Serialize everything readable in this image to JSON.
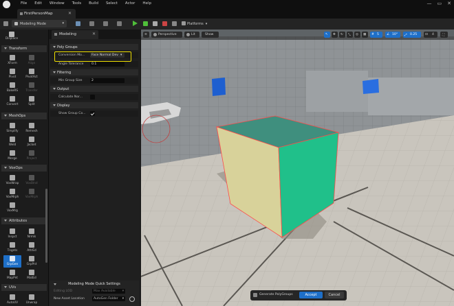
{
  "menubar": {
    "items": [
      "File",
      "Edit",
      "Window",
      "Tools",
      "Build",
      "Select",
      "Actor",
      "Help"
    ],
    "window_controls": [
      "—",
      "▭",
      "✕"
    ]
  },
  "tab": {
    "label": "FirstPersonMap",
    "close": "✕"
  },
  "toolbar": {
    "mode_label": "Modeling Mode",
    "platforms_label": "Platforms"
  },
  "left_panel": {
    "top_tool": "Displace",
    "sections": {
      "transform": "Transform",
      "meshops": "MeshOps",
      "voxops": "VoxOps",
      "attributes": "Attributes",
      "uvs": "UVs"
    },
    "transform_tools": [
      "XForm",
      "Align",
      "Pivot",
      "PivotAct",
      "BakeRS",
      "Transfer",
      "Convert",
      "Split"
    ],
    "meshops_tools": [
      "Simplify",
      "Remesh",
      "Weld",
      "Jacket",
      "Merge",
      "Project"
    ],
    "voxops_tools": [
      "VoxWrap",
      "VoxBlnd",
      "VoxMrph",
      "VoxMrph",
      "VoxMrg"
    ],
    "attribute_tools": [
      "Inspct",
      "Nrmls",
      "Tngnts",
      "AttrEd",
      "GrpGen",
      "GrpPnt",
      "MapPnt",
      "MatEd"
    ],
    "uv_tools": [
      "AutoUV",
      "Unwrap"
    ]
  },
  "detail_panel": {
    "tab_label": "Modeling",
    "tab_close": "✕",
    "polygroups": {
      "header": "Poly Groups",
      "conversion_label": "Conversion Mo...",
      "conversion_value": "Face Normal Dev",
      "angle_label": "Angle Tolerance",
      "angle_value": "0.1"
    },
    "filtering": {
      "header": "Filtering",
      "min_group_label": "Min Group Size",
      "min_group_value": "2"
    },
    "output": {
      "header": "Output",
      "calc_label": "Calculate Nor...",
      "calc_checked": false
    },
    "display": {
      "header": "Display",
      "show_label": "Show Group Co...",
      "show_checked": true
    }
  },
  "quick_settings": {
    "title": "Modeling Mode Quick Settings",
    "editing_label": "Editing LOD",
    "editing_value": "Max Available",
    "asset_label": "New Asset Location",
    "asset_value": "AutoGen Folder"
  },
  "viewport": {
    "perspective_label": "Perspective",
    "lit_label": "Lit",
    "show_label": "Show",
    "grid_value": "5",
    "angle_value": "10°",
    "scale_value": "0.25",
    "cam_value": "4"
  },
  "genbar": {
    "label": "Generate PolyGroups",
    "accept": "Accept",
    "cancel": "Cancel"
  },
  "colors": {
    "accent": "#1e6fc8",
    "highlight": "#f0e000",
    "cube_top": "#3f8f7e",
    "cube_front": "#d8d29a",
    "cube_right": "#20c08a",
    "edge": "#ff4a4a"
  }
}
